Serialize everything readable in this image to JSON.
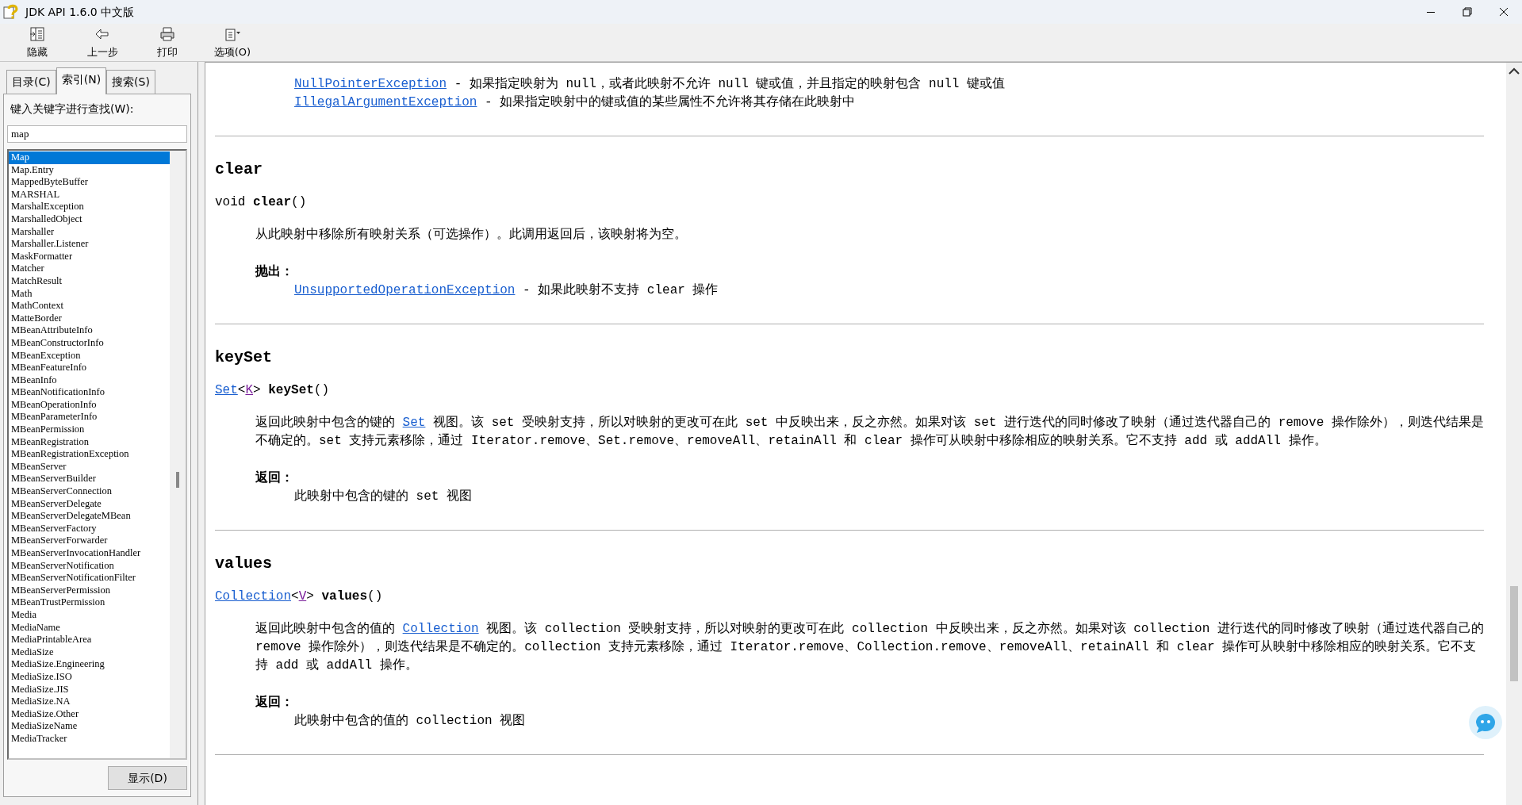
{
  "window": {
    "title": "JDK API 1.6.0 中文版"
  },
  "toolbar": [
    {
      "label": "隐藏",
      "kind": "hide"
    },
    {
      "label": "上一步",
      "kind": "back"
    },
    {
      "label": "打印",
      "kind": "print"
    },
    {
      "label": "选项(O)",
      "kind": "options"
    }
  ],
  "tabs": [
    {
      "label": "目录(C)",
      "selected": false
    },
    {
      "label": "索引(N)",
      "selected": true
    },
    {
      "label": "搜索(S)",
      "selected": false
    }
  ],
  "search": {
    "label": "键入关键字进行查找(W):",
    "value": "map"
  },
  "index_list": [
    {
      "label": "Map",
      "selected": true
    },
    {
      "label": "Map.Entry",
      "selected": false
    },
    {
      "label": "MappedByteBuffer",
      "selected": false
    },
    {
      "label": "MARSHAL",
      "selected": false
    },
    {
      "label": "MarshalException",
      "selected": false
    },
    {
      "label": "MarshalledObject",
      "selected": false
    },
    {
      "label": "Marshaller",
      "selected": false
    },
    {
      "label": "Marshaller.Listener",
      "selected": false
    },
    {
      "label": "MaskFormatter",
      "selected": false
    },
    {
      "label": "Matcher",
      "selected": false
    },
    {
      "label": "MatchResult",
      "selected": false
    },
    {
      "label": "Math",
      "selected": false
    },
    {
      "label": "MathContext",
      "selected": false
    },
    {
      "label": "MatteBorder",
      "selected": false
    },
    {
      "label": "MBeanAttributeInfo",
      "selected": false
    },
    {
      "label": "MBeanConstructorInfo",
      "selected": false
    },
    {
      "label": "MBeanException",
      "selected": false
    },
    {
      "label": "MBeanFeatureInfo",
      "selected": false
    },
    {
      "label": "MBeanInfo",
      "selected": false
    },
    {
      "label": "MBeanNotificationInfo",
      "selected": false
    },
    {
      "label": "MBeanOperationInfo",
      "selected": false
    },
    {
      "label": "MBeanParameterInfo",
      "selected": false
    },
    {
      "label": "MBeanPermission",
      "selected": false
    },
    {
      "label": "MBeanRegistration",
      "selected": false
    },
    {
      "label": "MBeanRegistrationException",
      "selected": false
    },
    {
      "label": "MBeanServer",
      "selected": false
    },
    {
      "label": "MBeanServerBuilder",
      "selected": false
    },
    {
      "label": "MBeanServerConnection",
      "selected": false
    },
    {
      "label": "MBeanServerDelegate",
      "selected": false
    },
    {
      "label": "MBeanServerDelegateMBean",
      "selected": false
    },
    {
      "label": "MBeanServerFactory",
      "selected": false
    },
    {
      "label": "MBeanServerForwarder",
      "selected": false
    },
    {
      "label": "MBeanServerInvocationHandler",
      "selected": false
    },
    {
      "label": "MBeanServerNotification",
      "selected": false
    },
    {
      "label": "MBeanServerNotificationFilter",
      "selected": false
    },
    {
      "label": "MBeanServerPermission",
      "selected": false
    },
    {
      "label": "MBeanTrustPermission",
      "selected": false
    },
    {
      "label": "Media",
      "selected": false
    },
    {
      "label": "MediaName",
      "selected": false
    },
    {
      "label": "MediaPrintableArea",
      "selected": false
    },
    {
      "label": "MediaSize",
      "selected": false
    },
    {
      "label": "MediaSize.Engineering",
      "selected": false
    },
    {
      "label": "MediaSize.ISO",
      "selected": false
    },
    {
      "label": "MediaSize.JIS",
      "selected": false
    },
    {
      "label": "MediaSize.NA",
      "selected": false
    },
    {
      "label": "MediaSize.Other",
      "selected": false
    },
    {
      "label": "MediaSizeName",
      "selected": false
    },
    {
      "label": "MediaTracker",
      "selected": false
    }
  ],
  "show_button": "显示(D)",
  "sections": [
    {
      "block": {
        "entries": [
          [
            {
              "kind": "link",
              "text": "NullPointerException"
            },
            {
              "kind": "plain",
              "text": " - 如果指定映射为 null，或者此映射不允许 null 键或值，并且指定的映射包含 null 键或值"
            }
          ],
          [
            {
              "kind": "link",
              "text": "IllegalArgumentException"
            },
            {
              "kind": "plain",
              "text": " - 如果指定映射中的键或值的某些属性不允许将其存储在此映射中"
            }
          ]
        ]
      }
    },
    {
      "name": "clear",
      "signature": [
        {
          "kind": "plain",
          "text": "void "
        },
        {
          "kind": "bold",
          "text": "clear"
        },
        {
          "kind": "plain",
          "text": "()"
        }
      ],
      "description": [
        {
          "kind": "plain",
          "text": "从此映射中移除所有映射关系（可选操作）。此调用返回后，该映射将为空。"
        }
      ],
      "block": {
        "label": "抛出：",
        "entries": [
          [
            {
              "kind": "link",
              "text": "UnsupportedOperationException"
            },
            {
              "kind": "plain",
              "text": " - 如果此映射不支持 clear 操作"
            }
          ]
        ]
      }
    },
    {
      "name": "keySet",
      "signature": [
        {
          "kind": "link",
          "text": "Set"
        },
        {
          "kind": "plain",
          "text": "<"
        },
        {
          "kind": "visited-link",
          "text": "K"
        },
        {
          "kind": "plain",
          "text": "> "
        },
        {
          "kind": "bold",
          "text": "keySet"
        },
        {
          "kind": "plain",
          "text": "()"
        }
      ],
      "description": [
        {
          "kind": "plain",
          "text": "返回此映射中包含的键的 "
        },
        {
          "kind": "link",
          "text": "Set"
        },
        {
          "kind": "plain",
          "text": " 视图。该 set 受映射支持，所以对映射的更改可在此 set 中反映出来，反之亦然。如果对该 set 进行迭代的同时修改了映射（通过迭代器自己的 remove 操作除外），则迭代结果是不确定的。set 支持元素移除，通过 Iterator.remove、Set.remove、removeAll、retainAll 和 clear 操作可从映射中移除相应的映射关系。它不支持 add 或 addAll 操作。"
        }
      ],
      "block": {
        "label": "返回：",
        "entries": [
          [
            {
              "kind": "plain",
              "text": "此映射中包含的键的 set 视图"
            }
          ]
        ]
      }
    },
    {
      "name": "values",
      "signature": [
        {
          "kind": "link",
          "text": "Collection"
        },
        {
          "kind": "plain",
          "text": "<"
        },
        {
          "kind": "visited-link",
          "text": "V"
        },
        {
          "kind": "plain",
          "text": "> "
        },
        {
          "kind": "bold",
          "text": "values"
        },
        {
          "kind": "plain",
          "text": "()"
        }
      ],
      "description": [
        {
          "kind": "plain",
          "text": "返回此映射中包含的值的 "
        },
        {
          "kind": "link",
          "text": "Collection"
        },
        {
          "kind": "plain",
          "text": " 视图。该 collection 受映射支持，所以对映射的更改可在此 collection 中反映出来，反之亦然。如果对该 collection 进行迭代的同时修改了映射（通过迭代器自己的 remove 操作除外），则迭代结果是不确定的。collection 支持元素移除，通过 Iterator.remove、Collection.remove、removeAll、retainAll 和 clear 操作可从映射中移除相应的映射关系。它不支持 add 或 addAll 操作。"
        }
      ],
      "block": {
        "label": "返回：",
        "entries": [
          [
            {
              "kind": "plain",
              "text": "此映射中包含的值的 collection 视图"
            }
          ]
        ]
      }
    }
  ]
}
